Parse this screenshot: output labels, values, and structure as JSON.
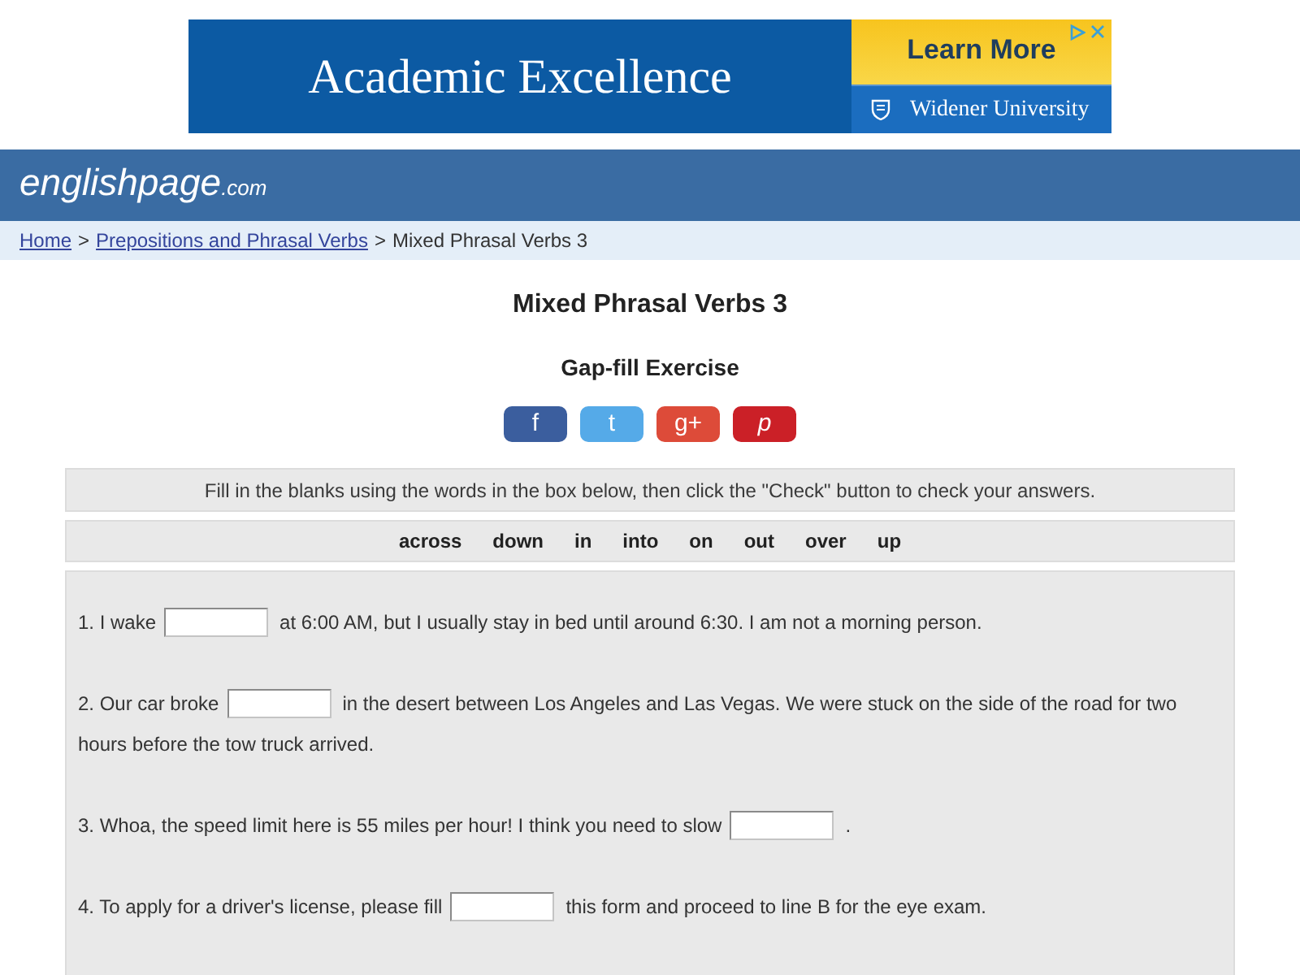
{
  "ad": {
    "headline": "Academic Excellence",
    "button": "Learn More",
    "sponsor": "Widener University"
  },
  "header": {
    "logo": "englishpage",
    "logo_suffix": ".com"
  },
  "breadcrumb": [
    {
      "kind": "link",
      "label": "Home"
    },
    {
      "kind": "separator",
      "label": ">"
    },
    {
      "kind": "link",
      "label": "Prepositions and Phrasal Verbs"
    },
    {
      "kind": "separator",
      "label": ">"
    },
    {
      "kind": "current",
      "label": "Mixed Phrasal Verbs 3"
    }
  ],
  "title": "Mixed Phrasal Verbs 3",
  "subtitle": "Gap-fill Exercise",
  "share_buttons": [
    {
      "label": "f",
      "color": "#3b5e9e",
      "italic": false
    },
    {
      "label": "t",
      "color": "#55aae8",
      "italic": false
    },
    {
      "label": "g+",
      "color": "#dd4b39",
      "italic": false
    },
    {
      "label": "p",
      "color": "#cb2027",
      "italic": true
    }
  ],
  "instructions": "Fill in the blanks using the words in the box below, then click the \"Check\" button to check your answers.",
  "word_bank": [
    "across",
    "down",
    "in",
    "into",
    "on",
    "out",
    "over",
    "up"
  ],
  "questions": [
    {
      "before": "1. I wake",
      "after": "at 6:00 AM, but I usually stay in bed until around 6:30. I am not a morning person."
    },
    {
      "before": "2. Our car broke",
      "after": "in the desert between Los Angeles and Las Vegas. We were stuck on the side of the road for two",
      "next_line": "hours before the tow truck arrived."
    },
    {
      "before": "3. Whoa, the speed limit here is 55 miles per hour! I think you need to slow",
      "after": "."
    },
    {
      "before": "4. To apply for a driver's license, please fill",
      "after": "this form and proceed to line B for the eye exam."
    }
  ]
}
